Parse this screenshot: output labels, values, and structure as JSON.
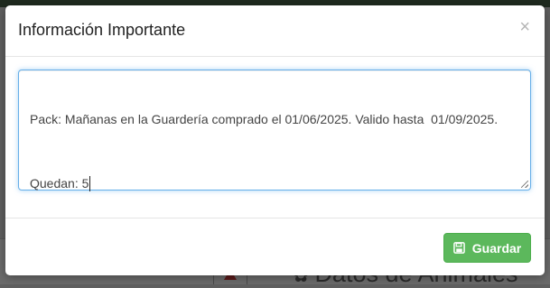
{
  "modal": {
    "title": "Información Importante",
    "close_label": "×",
    "note": {
      "line1": "Pack: Mañanas en la Guardería comprado el 01/06/2025. Valido hasta  01/09/2025.",
      "line2": "Quedan: 5"
    },
    "save_label": "Guardar",
    "colors": {
      "save_button": "#5cb85c",
      "focus_border": "#66afe9"
    }
  },
  "background": {
    "heading": "Datos de Animales",
    "heading_icon": "paw-icon",
    "warning_icon": "warning-icon"
  }
}
